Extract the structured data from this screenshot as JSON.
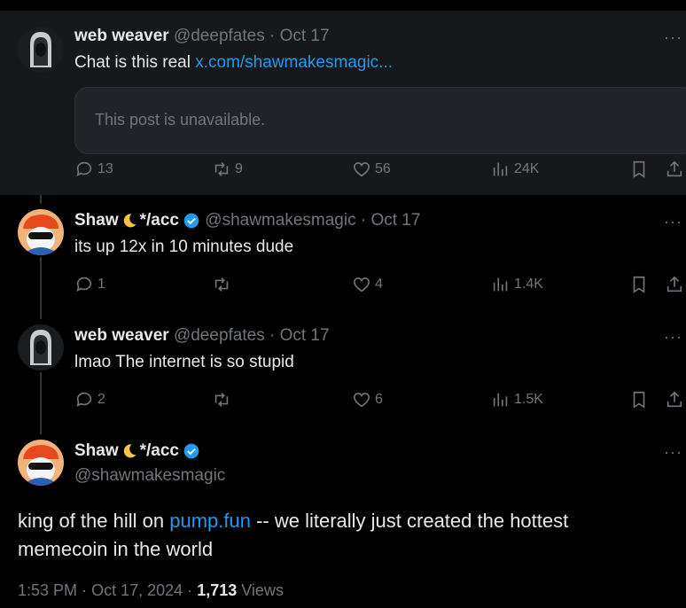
{
  "tweets": [
    {
      "name": "web weaver",
      "handle": "@deepfates",
      "date": "Oct 17",
      "text_before": "Chat is this real ",
      "link": "x.com/shawmakesmagic...",
      "quote_text": "This post is unavailable.",
      "replies": "13",
      "reposts": "9",
      "likes": "56",
      "views": "24K"
    },
    {
      "name": "Shaw",
      "name_suffix": "*/acc",
      "handle": "@shawmakesmagic",
      "date": "Oct 17",
      "text": "its up 12x in 10 minutes dude",
      "replies": "1",
      "reposts": "",
      "likes": "4",
      "views": "1.4K"
    },
    {
      "name": "web weaver",
      "handle": "@deepfates",
      "date": "Oct 17",
      "text": "lmao The internet is so stupid",
      "replies": "2",
      "reposts": "",
      "likes": "6",
      "views": "1.5K"
    }
  ],
  "main": {
    "name": "Shaw",
    "name_suffix": "*/acc",
    "handle": "@shawmakesmagic",
    "text_before": "king of the hill on ",
    "link": "pump.fun",
    "text_after": " -- we literally just created the hottest memecoin in the world",
    "time": "1:53 PM",
    "date": "Oct 17, 2024",
    "views_count": "1,713",
    "views_label": "Views"
  },
  "ui": {
    "separator": "·",
    "more": "···"
  },
  "colors": {
    "link": "#1d9bf0",
    "verified": "#1d9bf0",
    "muted": "#71767b",
    "text": "#e7e9ea"
  }
}
